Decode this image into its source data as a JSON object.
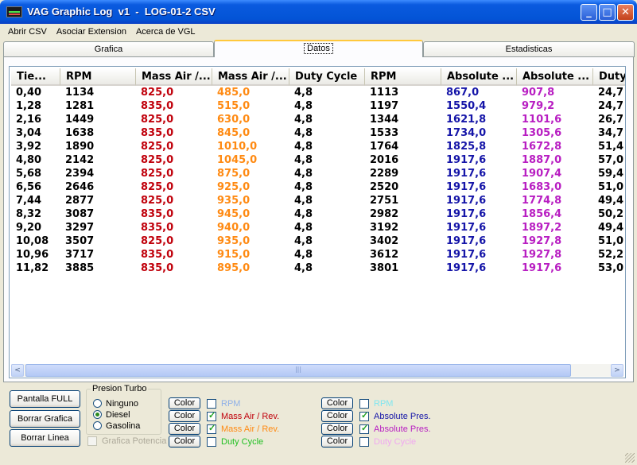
{
  "window": {
    "title": "VAG Graphic Log  v1  -  LOG-01-2 CSV",
    "minimize": "_",
    "maximize": "□",
    "close": "✕"
  },
  "menu": [
    "Abrir CSV",
    "Asociar Extension",
    "Acerca de VGL"
  ],
  "tabs": [
    "Grafica",
    "Datos",
    "Estadisticas"
  ],
  "active_tab": "Datos",
  "table": {
    "columns": [
      "Tie...",
      "RPM",
      "Mass Air /...",
      "Mass Air /...",
      "Duty Cycle",
      "RPM",
      "Absolute ...",
      "Absolute ...",
      "Duty"
    ],
    "column_colors": [
      "#000000",
      "#000000",
      "#c0000b",
      "#ff8a12",
      "#000000",
      "#000000",
      "#1515a8",
      "#b81ec2",
      "#000000"
    ],
    "rows": [
      [
        "0,40",
        "1134",
        "825,0",
        "485,0",
        "4,8",
        "1113",
        "867,0",
        "907,8",
        "24,7"
      ],
      [
        "1,28",
        "1281",
        "835,0",
        "515,0",
        "4,8",
        "1197",
        "1550,4",
        "979,2",
        "24,7"
      ],
      [
        "2,16",
        "1449",
        "825,0",
        "630,0",
        "4,8",
        "1344",
        "1621,8",
        "1101,6",
        "26,7"
      ],
      [
        "3,04",
        "1638",
        "835,0",
        "845,0",
        "4,8",
        "1533",
        "1734,0",
        "1305,6",
        "34,7"
      ],
      [
        "3,92",
        "1890",
        "825,0",
        "1010,0",
        "4,8",
        "1764",
        "1825,8",
        "1672,8",
        "51,4"
      ],
      [
        "4,80",
        "2142",
        "825,0",
        "1045,0",
        "4,8",
        "2016",
        "1917,6",
        "1887,0",
        "57,0"
      ],
      [
        "5,68",
        "2394",
        "825,0",
        "875,0",
        "4,8",
        "2289",
        "1917,6",
        "1907,4",
        "59,4"
      ],
      [
        "6,56",
        "2646",
        "825,0",
        "925,0",
        "4,8",
        "2520",
        "1917,6",
        "1683,0",
        "51,0"
      ],
      [
        "7,44",
        "2877",
        "825,0",
        "935,0",
        "4,8",
        "2751",
        "1917,6",
        "1774,8",
        "49,4"
      ],
      [
        "8,32",
        "3087",
        "835,0",
        "945,0",
        "4,8",
        "2982",
        "1917,6",
        "1856,4",
        "50,2"
      ],
      [
        "9,20",
        "3297",
        "835,0",
        "940,0",
        "4,8",
        "3192",
        "1917,6",
        "1897,2",
        "49,4"
      ],
      [
        "10,08",
        "3507",
        "825,0",
        "935,0",
        "4,8",
        "3402",
        "1917,6",
        "1927,8",
        "51,0"
      ],
      [
        "10,96",
        "3717",
        "835,0",
        "915,0",
        "4,8",
        "3612",
        "1917,6",
        "1927,8",
        "52,2"
      ],
      [
        "11,82",
        "3885",
        "835,0",
        "895,0",
        "4,8",
        "3801",
        "1917,6",
        "1917,6",
        "53,0"
      ]
    ]
  },
  "scrollbar": {
    "left_arrow": "<",
    "right_arrow": ">",
    "thumb_grip": "|||"
  },
  "buttons": {
    "fullscreen": "Pantalla  FULL",
    "clear_chart": "Borrar Grafica",
    "clear_line": "Borrar Linea"
  },
  "turbo": {
    "title": "Presion Turbo",
    "options": [
      "Ninguno",
      "Diesel",
      "Gasolina"
    ],
    "selected": "Diesel"
  },
  "power_chart": {
    "label": "Grafica Potencia",
    "checked": false,
    "enabled": false
  },
  "color_label": "Color",
  "series_left": [
    {
      "label": "RPM",
      "checked": false,
      "color": "#8fb0e8"
    },
    {
      "label": "Mass Air / Rev.",
      "checked": true,
      "color": "#c0000b"
    },
    {
      "label": "Mass Air / Rev.",
      "checked": true,
      "color": "#ff8a12"
    },
    {
      "label": "Duty Cycle",
      "checked": false,
      "color": "#22c022"
    }
  ],
  "series_right": [
    {
      "label": "RPM",
      "checked": false,
      "color": "#7fe6f0"
    },
    {
      "label": "Absolute Pres.",
      "checked": true,
      "color": "#1515a8"
    },
    {
      "label": "Absolute Pres.",
      "checked": true,
      "color": "#b81ec2"
    },
    {
      "label": "Duty Cycle",
      "checked": false,
      "color": "#f0a8f0"
    }
  ]
}
